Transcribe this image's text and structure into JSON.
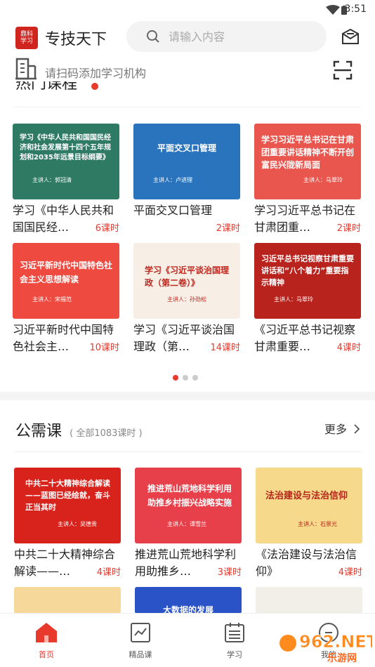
{
  "status_bar": {
    "time": "3:51"
  },
  "header": {
    "logo_text": "鼎科学习",
    "app_title": "专技天下",
    "search_placeholder": "请输入内容"
  },
  "scan_bar": {
    "hint": "请扫码添加学习机构"
  },
  "hot_section": {
    "title": "热门课程",
    "courses": [
      {
        "title": "学习《中华人民共和国国民经…",
        "count": "6课时",
        "thumb_title": "学习《中华人民共和国国民经济和社会发展第十四个五年规划和2035年远景目标纲要》",
        "lecturer": "主讲人：郭冠清",
        "bg": "#2e7a63",
        "fg": "#ffffff"
      },
      {
        "title": "平面交叉口管理",
        "count": "2课时",
        "thumb_title": "平面交叉口管理",
        "lecturer": "主讲人：卢进理",
        "bg": "#2a73bd",
        "fg": "#ffffff"
      },
      {
        "title": "学习习近平总书记在甘肃团重…",
        "count": "2课时",
        "thumb_title": "学习习近平总书记在甘肃团重要讲话精神不断开创富民兴陇新局面",
        "lecturer": "主讲人：马翠玲",
        "bg": "#e8564e",
        "fg": "#ffffff"
      },
      {
        "title": "习近平新时代中国特色社会主…",
        "count": "10课时",
        "thumb_title": "习近平新时代中国特色社会主义思想解读",
        "lecturer": "主讲人：宋福范",
        "bg": "#ef4a40",
        "fg": "#ffffff"
      },
      {
        "title": "学习《习近平谈治国理政（第…",
        "count": "14课时",
        "thumb_title": "学习《习近平谈治国理政（第二卷）》",
        "lecturer": "主讲人：孙劲松",
        "bg": "#f7efe6",
        "fg": "#c0271f"
      },
      {
        "title": "《习近平总书记视察甘肃重要…",
        "count": "4课时",
        "thumb_title": "习近平总书记视察甘肃重要讲话和“八个着力”重要指示精神",
        "lecturer": "主讲人：马翠玲",
        "bg": "#b8231d",
        "fg": "#ffffff"
      }
    ],
    "pager": {
      "pages": 3,
      "active": 0
    }
  },
  "public_section": {
    "title": "公需课",
    "subtitle": "( 全部1083课时 )",
    "more": "更多",
    "courses": [
      {
        "title": "中共二十大精神综合解读——…",
        "count": "4课时",
        "thumb_title": "中共二十大精神综合解读——蓝图已经绘就，奋斗正当其时",
        "lecturer": "主讲人：吴德贵",
        "bg": "#d8231c",
        "fg": "#ffffff"
      },
      {
        "title": "推进荒山荒地科学利用助推乡…",
        "count": "3课时",
        "thumb_title": "推进荒山荒地科学利用助推乡村振兴战略实施",
        "lecturer": "主讲人：谭雪兰",
        "bg": "#e8404a",
        "fg": "#ffffff"
      },
      {
        "title": "《法治建设与法治信仰》",
        "count": "4课时",
        "thumb_title": "法治建设与法治信仰",
        "lecturer": "主讲人：石景光",
        "bg": "#f6d98a",
        "fg": "#b6231a"
      }
    ],
    "peek": [
      {
        "bg": "#f5d89a"
      },
      {
        "bg": "#2a53c8",
        "thumb_title": "大数据的发展"
      },
      {
        "bg": "#f2efe8"
      }
    ]
  },
  "tabbar": {
    "items": [
      {
        "label": "首页"
      },
      {
        "label": "精品课"
      },
      {
        "label": "学习"
      },
      {
        "label": "我的"
      }
    ]
  },
  "watermark": {
    "text": "962.NET",
    "sub": "乐游网"
  },
  "colors": {
    "accent": "#e8392d"
  }
}
